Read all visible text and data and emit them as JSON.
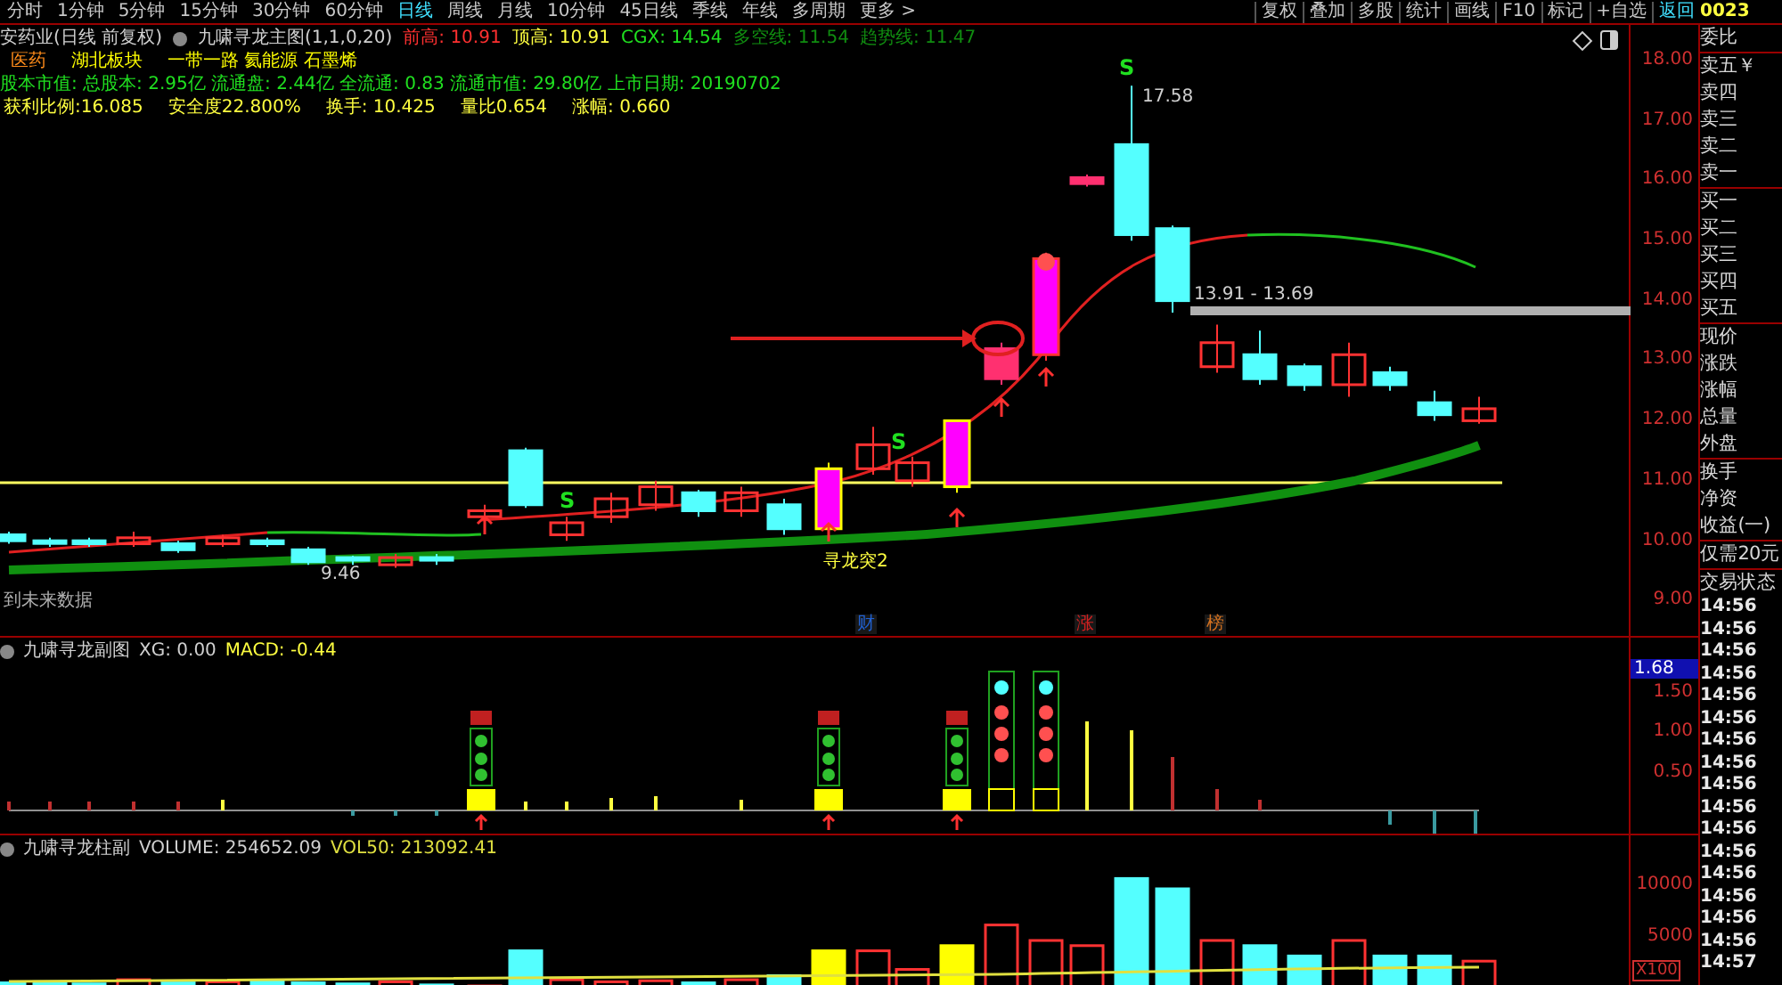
{
  "toolbar": {
    "periods": [
      {
        "label": "分时",
        "selected": false
      },
      {
        "label": "1分钟",
        "selected": false
      },
      {
        "label": "5分钟",
        "selected": false
      },
      {
        "label": "15分钟",
        "selected": false
      },
      {
        "label": "30分钟",
        "selected": false
      },
      {
        "label": "60分钟",
        "selected": false
      },
      {
        "label": "日线",
        "selected": true
      },
      {
        "label": "周线",
        "selected": false
      },
      {
        "label": "月线",
        "selected": false
      },
      {
        "label": "10分钟",
        "selected": false
      },
      {
        "label": "45日线",
        "selected": false
      },
      {
        "label": "季线",
        "selected": false
      },
      {
        "label": "年线",
        "selected": false
      },
      {
        "label": "多周期",
        "selected": false
      },
      {
        "label": "更多 >",
        "selected": false
      }
    ],
    "actions": [
      {
        "label": "复权",
        "highlighted": false
      },
      {
        "label": "叠加",
        "highlighted": false
      },
      {
        "label": "多股",
        "highlighted": false
      },
      {
        "label": "统计",
        "highlighted": false
      },
      {
        "label": "画线",
        "highlighted": false
      },
      {
        "label": "F10",
        "highlighted": false
      },
      {
        "label": "标记",
        "highlighted": false
      },
      {
        "label": "+自选",
        "highlighted": false
      },
      {
        "label": "返回",
        "highlighted": true
      }
    ]
  },
  "stock_code": "0023",
  "header": {
    "stock_name": "安药业(日线 前复权)",
    "indicator": "九啸寻龙主图(1,1,0,20)",
    "values": [
      {
        "label": "前高:",
        "value": "10.91",
        "color": "#ff3030"
      },
      {
        "label": "顶高:",
        "value": "10.91",
        "color": "#ffff40"
      },
      {
        "label": "CGX:",
        "value": "14.54",
        "color": "#20e020"
      },
      {
        "label": "多空线:",
        "value": "11.54",
        "color": "#108c10"
      },
      {
        "label": "趋势线:",
        "value": "11.47",
        "color": "#108c10"
      }
    ]
  },
  "tags": [
    {
      "label": "医药",
      "color": "#ff8c1a"
    },
    {
      "label": "湖北板块",
      "color": "#ffff00"
    },
    {
      "label": "一带一路 氦能源 石墨烯",
      "color": "#ffff00"
    }
  ],
  "fundamentals": "股本市值: 总股本: 2.95亿 流通盘: 2.44亿 全流通: 0.83 流通市值: 29.80亿 上市日期: 20190702",
  "stats": [
    "获利比例:16.085",
    "安全度22.800%",
    "换手: 10.425",
    "量比0.654",
    "涨幅: 0.660"
  ],
  "main_chart": {
    "annotations": [
      {
        "kind": "signal",
        "text": "S"
      },
      {
        "kind": "price",
        "text": "17.58"
      },
      {
        "kind": "price",
        "text": "13.91 - 13.69"
      },
      {
        "kind": "signal",
        "text": "S"
      },
      {
        "kind": "signal",
        "text": "S"
      },
      {
        "kind": "label",
        "text": "寻龙突2"
      },
      {
        "kind": "price",
        "text": "9.46"
      }
    ],
    "price_axis": [
      "18.00",
      "17.00",
      "16.00",
      "15.00",
      "14.00",
      "13.00",
      "12.00",
      "11.00",
      "10.00",
      "9.00"
    ],
    "note": "到未来数据",
    "event_markers": [
      {
        "label": "财",
        "color": "#2060d0"
      },
      {
        "label": "涨",
        "color": "#d02020"
      },
      {
        "label": "榜",
        "color": "#d07020"
      }
    ]
  },
  "sub_chart": {
    "indicator": "九啸寻龙副图",
    "values": [
      {
        "text": "XG: 0.00",
        "color": "#d0d0d0"
      },
      {
        "text": "MACD: -0.44",
        "color": "#ffff40"
      }
    ],
    "current": "1.68",
    "axis": [
      "1.50",
      "1.00",
      "0.50"
    ]
  },
  "volume_chart": {
    "indicator": "九啸寻龙柱副",
    "values": [
      {
        "text": "VOLUME: 254652.09",
        "color": "#d0d0d0"
      },
      {
        "text": "VOL50: 213092.41",
        "color": "#e0e040"
      }
    ],
    "axis": [
      "10000",
      "5000"
    ],
    "unit": "X100"
  },
  "quote_panel": {
    "groups": [
      [
        "委比"
      ],
      [
        "卖五￥",
        "卖四",
        "卖三",
        "卖二",
        "卖一"
      ],
      [
        "买一",
        "买二",
        "买三",
        "买四",
        "买五"
      ],
      [
        "现价",
        "涨跌",
        "涨幅",
        "总量",
        "外盘"
      ],
      [
        "换手",
        "净资",
        "收益(一)"
      ],
      [
        "仅需20元"
      ],
      [
        "交易状态"
      ]
    ],
    "times": [
      "14:56",
      "14:56",
      "14:56",
      "14:56",
      "14:56",
      "14:56",
      "14:56",
      "14:56",
      "14:56",
      "14:56",
      "14:56",
      "14:56",
      "14:56",
      "14:56",
      "14:56",
      "14:56",
      "14:57"
    ]
  }
}
